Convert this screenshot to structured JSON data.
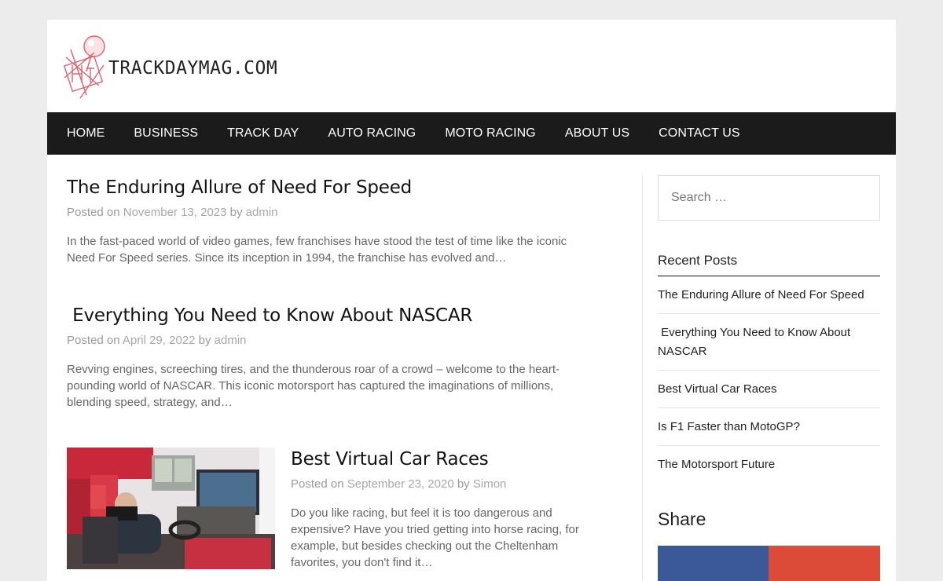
{
  "site": {
    "logo_text": "TRACKDAYMAG.COM"
  },
  "nav": {
    "items": [
      "HOME",
      "BUSINESS",
      "TRACK DAY",
      "AUTO RACING",
      "MOTO RACING",
      "ABOUT US",
      "CONTACT US"
    ]
  },
  "posts": [
    {
      "title": "The Enduring Allure of Need For Speed",
      "posted_on_label": "Posted on",
      "date": "November 13, 2023",
      "by_label": "by",
      "author": "admin",
      "excerpt": "In the fast-paced world of video games, few franchises have stood the test of time like the iconic Need For Speed series. Since its inception in 1994, the franchise has evolved and…"
    },
    {
      "title": " Everything You Need to Know About NASCAR",
      "posted_on_label": "Posted on",
      "date": "April 29, 2022",
      "by_label": "by",
      "author": "admin",
      "excerpt": "Revving engines, screeching tires, and the thunderous roar of a crowd – welcome to the heart-pounding world of NASCAR. This iconic motorsport has captured the imaginations of millions, blending speed, strategy, and…"
    },
    {
      "title": "Best Virtual Car Races",
      "posted_on_label": "Posted on",
      "date": "September 23, 2020",
      "by_label": "by",
      "author": "Simon",
      "excerpt": "Do you like racing, but feel it is too dangerous and expensive? Have you tried getting into horse racing, for example, but besides checking out the Cheltenham favorites, you don't find it…"
    }
  ],
  "sidebar": {
    "search_placeholder": "Search …",
    "recent_posts_title": "Recent Posts",
    "recent_posts": [
      "The Enduring Allure of Need For Speed",
      " Everything You Need to Know About NASCAR",
      "Best Virtual Car Races",
      "Is F1 Faster than MotoGP?",
      "The Motorsport Future"
    ],
    "share_title": "Share"
  },
  "colors": {
    "nav_bg": "#1b1b1b",
    "logo_accent": "#e0606a",
    "facebook": "#3b5998",
    "google_plus": "#dc4a38"
  }
}
